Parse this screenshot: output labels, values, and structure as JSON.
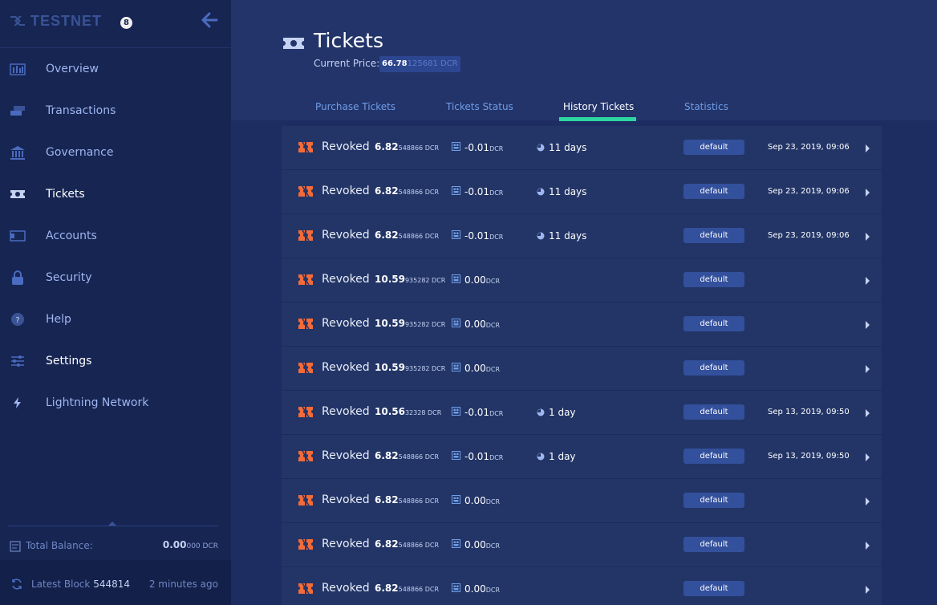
{
  "sidebar": {
    "network_label": "TESTNET",
    "network_badge": "8",
    "nav": [
      {
        "label": "Overview",
        "icon": "overview-icon"
      },
      {
        "label": "Transactions",
        "icon": "transactions-icon"
      },
      {
        "label": "Governance",
        "icon": "governance-icon"
      },
      {
        "label": "Tickets",
        "icon": "tickets-icon"
      },
      {
        "label": "Accounts",
        "icon": "accounts-icon"
      },
      {
        "label": "Security",
        "icon": "lock-icon"
      },
      {
        "label": "Help",
        "icon": "help-icon"
      },
      {
        "label": "Settings",
        "icon": "settings-icon"
      },
      {
        "label": "Lightning Network",
        "icon": "lightning-icon"
      }
    ],
    "total_balance_label": "Total Balance:",
    "total_balance_main": "0.00",
    "total_balance_rest": "000 DCR",
    "latest_block_label": "Latest Block",
    "latest_block_number": "544814",
    "latest_block_time": "2 minutes ago"
  },
  "header": {
    "title": "Tickets",
    "price_label": "Current Price:",
    "price_main": "66.78",
    "price_rest": "125681 DCR"
  },
  "tabs": [
    "Purchase Tickets",
    "Tickets Status",
    "History Tickets",
    "Statistics"
  ],
  "rows": [
    {
      "status": "Revoked",
      "amount_main": "6.82",
      "amount_rest": "548866 DCR",
      "fee_main": "-0.01",
      "fee_unit": "DCR",
      "days": "11 days",
      "account": "default",
      "date": "Sep 23, 2019, 09:06"
    },
    {
      "status": "Revoked",
      "amount_main": "6.82",
      "amount_rest": "548866 DCR",
      "fee_main": "-0.01",
      "fee_unit": "DCR",
      "days": "11 days",
      "account": "default",
      "date": "Sep 23, 2019, 09:06"
    },
    {
      "status": "Revoked",
      "amount_main": "6.82",
      "amount_rest": "548866 DCR",
      "fee_main": "-0.01",
      "fee_unit": "DCR",
      "days": "11 days",
      "account": "default",
      "date": "Sep 23, 2019, 09:06"
    },
    {
      "status": "Revoked",
      "amount_main": "10.59",
      "amount_rest": "935282 DCR",
      "fee_main": "0.00",
      "fee_unit": "DCR",
      "days": "",
      "account": "default",
      "date": ""
    },
    {
      "status": "Revoked",
      "amount_main": "10.59",
      "amount_rest": "935282 DCR",
      "fee_main": "0.00",
      "fee_unit": "DCR",
      "days": "",
      "account": "default",
      "date": ""
    },
    {
      "status": "Revoked",
      "amount_main": "10.59",
      "amount_rest": "935282 DCR",
      "fee_main": "0.00",
      "fee_unit": "DCR",
      "days": "",
      "account": "default",
      "date": ""
    },
    {
      "status": "Revoked",
      "amount_main": "10.56",
      "amount_rest": "32328 DCR",
      "fee_main": "-0.01",
      "fee_unit": "DCR",
      "days": "1 day",
      "account": "default",
      "date": "Sep 13, 2019, 09:50"
    },
    {
      "status": "Revoked",
      "amount_main": "6.82",
      "amount_rest": "548866 DCR",
      "fee_main": "-0.01",
      "fee_unit": "DCR",
      "days": "1 day",
      "account": "default",
      "date": "Sep 13, 2019, 09:50"
    },
    {
      "status": "Revoked",
      "amount_main": "6.82",
      "amount_rest": "548866 DCR",
      "fee_main": "0.00",
      "fee_unit": "DCR",
      "days": "",
      "account": "default",
      "date": ""
    },
    {
      "status": "Revoked",
      "amount_main": "6.82",
      "amount_rest": "548866 DCR",
      "fee_main": "0.00",
      "fee_unit": "DCR",
      "days": "",
      "account": "default",
      "date": ""
    },
    {
      "status": "Revoked",
      "amount_main": "6.82",
      "amount_rest": "548866 DCR",
      "fee_main": "0.00",
      "fee_unit": "DCR",
      "days": "",
      "account": "default",
      "date": ""
    }
  ],
  "colors": {
    "accent": "#2ed6a1",
    "ticket_icon": "#f26b3a",
    "sidebar_bg": "#162552",
    "main_bg": "#1d2c61"
  }
}
